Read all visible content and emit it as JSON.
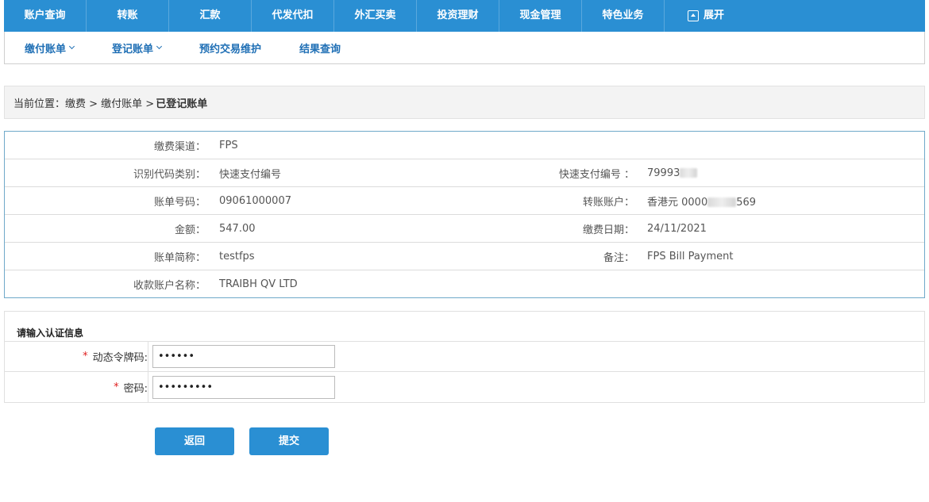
{
  "topnav": {
    "items": [
      "账户查询",
      "转账",
      "汇款",
      "代发代扣",
      "外汇买卖",
      "投资理财",
      "现金管理",
      "特色业务"
    ],
    "expand_label": "展开"
  },
  "subnav": {
    "items": [
      "缴付账单",
      "登记账单",
      "预约交易维护",
      "结果查询"
    ]
  },
  "breadcrumb": {
    "prefix": "当前位置：缴费 > 缴付账单 >",
    "current": "已登记账单"
  },
  "details": {
    "channel_label": "缴费渠道：",
    "channel_value": "FPS",
    "idtype_label": "识别代码类别：",
    "idtype_value": "快速支付编号",
    "fpsid_label": "快速支付编号 ：",
    "fpsid_value_prefix": "79993",
    "billno_label": "账单号码：",
    "billno_value": "09061000007",
    "account_label": "转账账户：",
    "account_value_prefix": "香港元 0000",
    "account_value_suffix": "569",
    "amount_label": "金额：",
    "amount_value": "547.00",
    "date_label": "缴费日期：",
    "date_value": "24/11/2021",
    "shortname_label": "账单简称：",
    "shortname_value": "testfps",
    "remark_label": "备注：",
    "remark_value": "FPS Bill Payment",
    "payee_label": "收款账户名称：",
    "payee_value": "TRAIBH QV LTD"
  },
  "auth": {
    "title": "请输入认证信息",
    "required_mark": "*",
    "token_label": "动态令牌码:",
    "token_value": "••••••",
    "password_label": "密码:",
    "password_value": "•••••••••"
  },
  "buttons": {
    "back": "返回",
    "submit": "提交"
  }
}
